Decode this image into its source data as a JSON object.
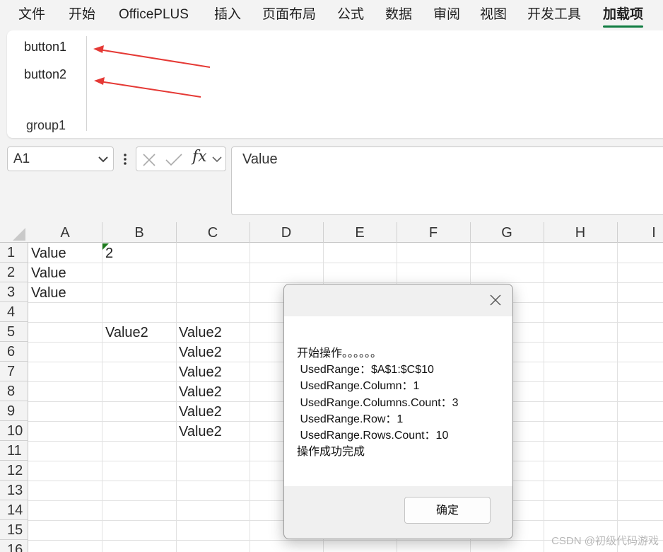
{
  "tabs": [
    "文件",
    "开始",
    "OfficePLUS",
    "插入",
    "页面布局",
    "公式",
    "数据",
    "审阅",
    "视图",
    "开发工具",
    "加载项"
  ],
  "active_tab": "加载项",
  "ribbon": {
    "button1": "button1",
    "button2": "button2",
    "group_label": "group1"
  },
  "name_box": {
    "value": "A1"
  },
  "formula_bar": {
    "value": "Value",
    "fx": "fx"
  },
  "columns": [
    "A",
    "B",
    "C",
    "D",
    "E",
    "F",
    "G",
    "H",
    "I"
  ],
  "rows": [
    "1",
    "2",
    "3",
    "4",
    "5",
    "6",
    "7",
    "8",
    "9",
    "10",
    "11",
    "12",
    "13",
    "14",
    "15",
    "16"
  ],
  "cells": {
    "A1": "Value",
    "B1": "2",
    "A2": "Value",
    "A3": "Value",
    "B5": "Value2",
    "C5": "Value2",
    "C6": "Value2",
    "C7": "Value2",
    "C8": "Value2",
    "C9": "Value2",
    "C10": "Value2"
  },
  "dialog": {
    "lines": [
      "开始操作。。。。。。",
      " UsedRange：$A$1:$C$10",
      " UsedRange.Column：1",
      " UsedRange.Columns.Count：3",
      " UsedRange.Row：1",
      " UsedRange.Rows.Count：10",
      "操作成功完成"
    ],
    "ok_label": "确定"
  },
  "watermark": "CSDN @初级代码游戏",
  "colors": {
    "accent": "#107c41",
    "annotation_arrow": "#e53935",
    "error_marker": "#1e7b1e"
  }
}
